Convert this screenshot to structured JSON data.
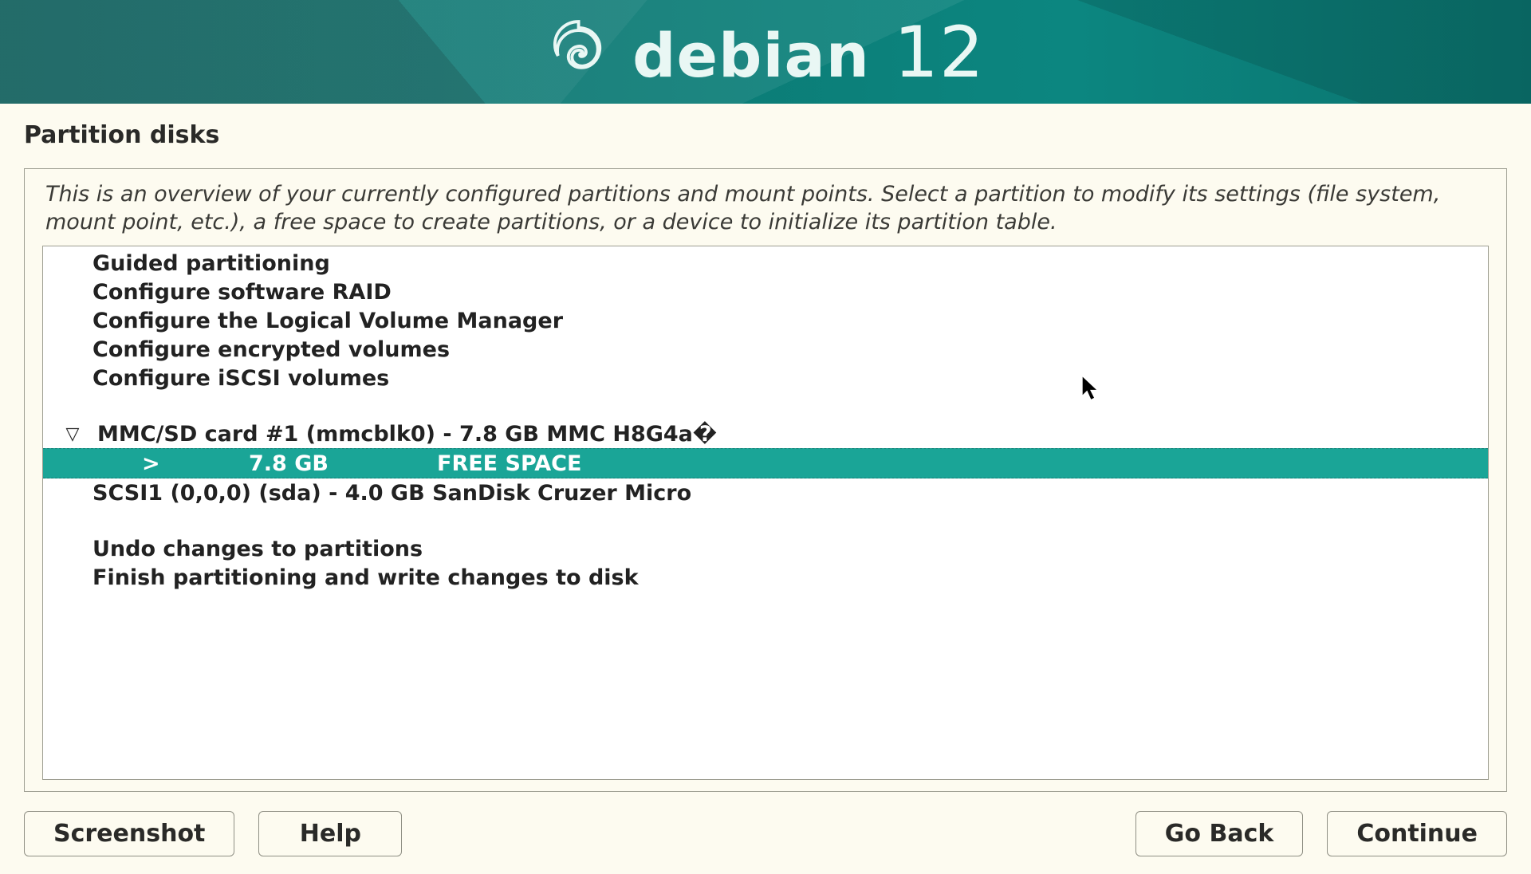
{
  "banner": {
    "name": "debian",
    "version": "12"
  },
  "page": {
    "title": "Partition disks",
    "description": "This is an overview of your currently configured partitions and mount points. Select a partition to modify its settings (file system, mount point, etc.), a free space to create partitions, or a device to initialize its partition table."
  },
  "options": {
    "guided": "Guided partitioning",
    "raid": "Configure software RAID",
    "lvm": "Configure the Logical Volume Manager",
    "encrypted": "Configure encrypted volumes",
    "iscsi": "Configure iSCSI volumes"
  },
  "devices": [
    {
      "id": "mmc",
      "label": "MMC/SD card #1 (mmcblk0) - 7.8 GB MMC H8G4a�",
      "expanded": true,
      "partitions": [
        {
          "prefix": ">",
          "size": "7.8 GB",
          "label": "FREE SPACE",
          "selected": true
        }
      ]
    },
    {
      "id": "sda",
      "label": "SCSI1 (0,0,0) (sda) - 4.0 GB SanDisk Cruzer Micro",
      "expanded": false,
      "partitions": []
    }
  ],
  "finish": {
    "undo": "Undo changes to partitions",
    "write": "Finish partitioning and write changes to disk"
  },
  "buttons": {
    "screenshot": "Screenshot",
    "help": "Help",
    "back": "Go Back",
    "continue": "Continue"
  }
}
